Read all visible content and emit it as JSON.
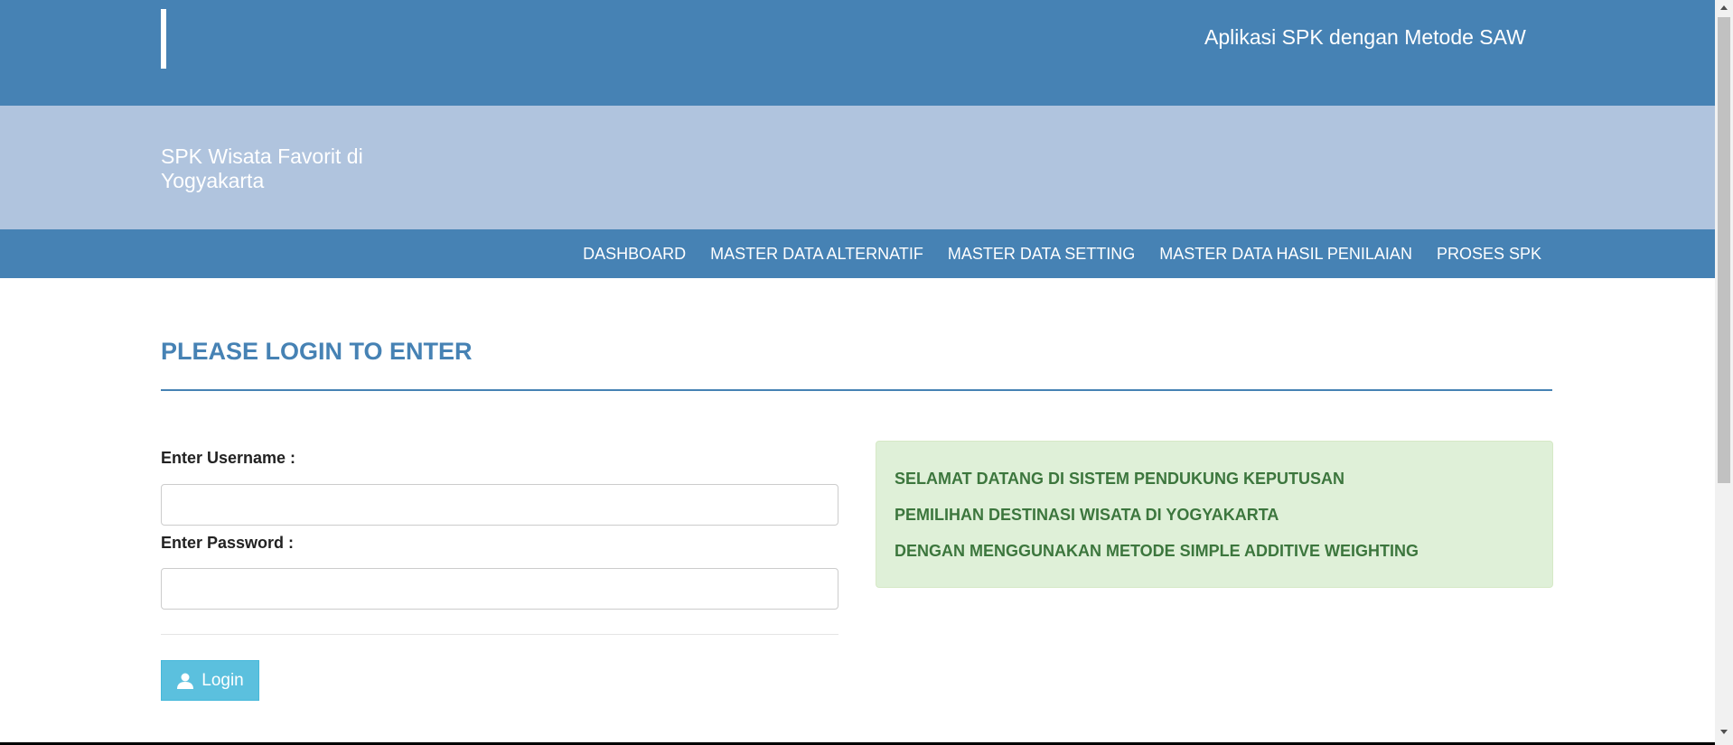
{
  "header": {
    "app_title": "Aplikasi SPK dengan Metode SAW"
  },
  "banner": {
    "site_title": "SPK Wisata Favorit di Yogyakarta"
  },
  "nav": {
    "items": [
      {
        "label": "DASHBOARD"
      },
      {
        "label": "MASTER DATA ALTERNATIF"
      },
      {
        "label": "MASTER DATA SETTING"
      },
      {
        "label": "MASTER DATA HASIL PENILAIAN"
      },
      {
        "label": "PROSES SPK"
      }
    ]
  },
  "login": {
    "heading": "PLEASE LOGIN TO ENTER",
    "username_label": "Enter Username :",
    "username_value": "",
    "password_label": "Enter Password :",
    "password_value": "",
    "button_label": "Login",
    "button_icon": "user-icon"
  },
  "welcome": {
    "lines": [
      "SELAMAT DATANG DI SISTEM PENDUKUNG KEPUTUSAN",
      "PEMILIHAN DESTINASI WISATA DI YOGYAKARTA",
      "DENGAN MENGGUNAKAN METODE SIMPLE ADDITIVE WEIGHTING"
    ]
  },
  "colors": {
    "primary": "#4682b4",
    "banner": "#b0c4de",
    "button": "#5bc0de",
    "alert_bg": "#dff0d8",
    "alert_text": "#3c763d"
  }
}
